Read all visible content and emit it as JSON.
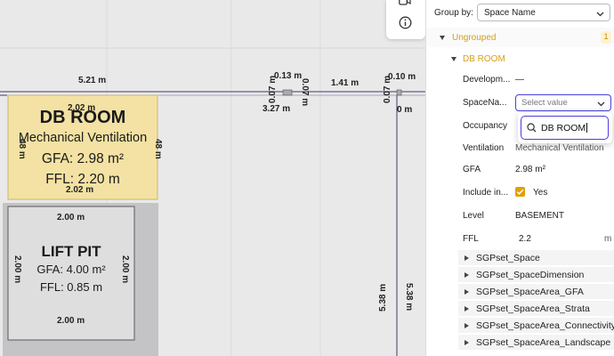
{
  "canvas": {
    "dimensions": {
      "top_5_21": "5.21 m",
      "top_2_02": "2.02 m",
      "d_0_13": "0.13 m",
      "d_0_07_a": "0.07 m",
      "d_0_07_b": "0.07 m",
      "d_0_07_c": "0.07 m",
      "d_1_41": "1.41 m",
      "d_0_10": "0.10 m",
      "d_3_27": "3.27 m",
      "d_0": "0 m",
      "db_left_48": "48 m",
      "db_right_48": "48 m",
      "db_bottom": "2.02 m",
      "lift_top": "2.00 m",
      "lift_left": "2.00 m",
      "lift_right": "2.00 m",
      "lift_bottom": "2.00 m",
      "r_5_38_a": "5.38 m",
      "r_5_38_b": "5.38 m"
    },
    "db_room": {
      "name": "DB ROOM",
      "ventilation": "Mechanical Ventilation",
      "gfa": "GFA: 2.98 m²",
      "ffl": "FFL: 2.20 m"
    },
    "lift_pit": {
      "name": "LIFT PIT",
      "gfa": "GFA: 4.00 m²",
      "ffl": "FFL: 0.85 m"
    },
    "colors": {
      "db_fill": "#f3e2a3",
      "lift_fill": "#dcdcdc",
      "canvas_bg": "#e9e9ea"
    }
  },
  "toolbar": {
    "icons": [
      "video-camera-icon",
      "info-icon"
    ]
  },
  "panel": {
    "group_by_label": "Group by:",
    "group_by_value": "Space Name",
    "group_label": "Ungrouped",
    "group_count": "1",
    "item_label": "DB ROOM",
    "properties": [
      {
        "key": "Developm...",
        "value": "—"
      },
      {
        "key": "SpaceNa...",
        "value": ""
      },
      {
        "key": "Occupancy",
        "value": ""
      },
      {
        "key": "Ventilation",
        "value": "Mechanical Ventilation"
      },
      {
        "key": "GFA",
        "value": "2.98 m²"
      },
      {
        "key": "Include in...",
        "value": "Yes"
      },
      {
        "key": "Level",
        "value": "BASEMENT"
      },
      {
        "key": "FFL",
        "value": "2.2",
        "unit": "m"
      }
    ],
    "space_name_select": {
      "placeholder": "Select value"
    },
    "search": {
      "value": "DB ROOM"
    },
    "psets": [
      "SGPset_Space",
      "SGPset_SpaceDimension",
      "SGPset_SpaceArea_GFA",
      "SGPset_SpaceArea_Strata",
      "SGPset_SpaceArea_Connectivity",
      "SGPset_SpaceArea_Landscape"
    ],
    "accent": "#d4a017",
    "focus_color": "#4a3fd6",
    "checkbox_color": "#e0a100"
  }
}
